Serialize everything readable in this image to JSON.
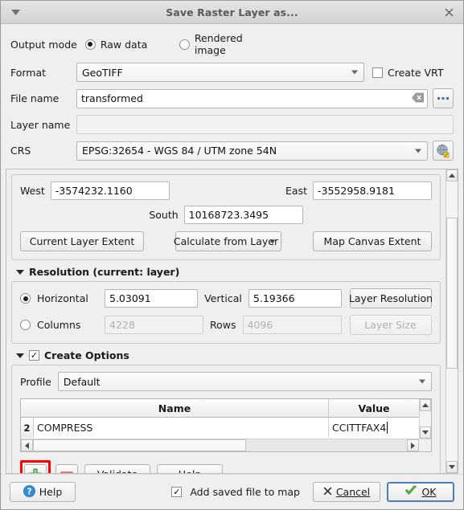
{
  "window": {
    "title": "Save Raster Layer as...",
    "menu_icon": "chevron-down-icon",
    "close_icon": "close-icon"
  },
  "output_mode": {
    "label": "Output mode",
    "options": [
      {
        "label": "Raw data",
        "selected": true
      },
      {
        "label": "Rendered image",
        "selected": false
      }
    ]
  },
  "format": {
    "label": "Format",
    "value": "GeoTIFF",
    "create_vrt": {
      "label": "Create VRT",
      "checked": false
    }
  },
  "file_name": {
    "label": "File name",
    "value": "transformed",
    "placeholder": "",
    "clear_icon": "clear-icon",
    "browse_label": "..."
  },
  "layer_name": {
    "label": "Layer name",
    "value": "",
    "placeholder": ""
  },
  "crs": {
    "label": "CRS",
    "value": "EPSG:32654 - WGS 84 / UTM zone 54N",
    "select_icon": "crs-globe-icon"
  },
  "extent": {
    "west": {
      "label": "West",
      "value": "-3574232.1160"
    },
    "east": {
      "label": "East",
      "value": "-3552958.9181"
    },
    "south": {
      "label": "South",
      "value": "10168723.3495"
    },
    "buttons": [
      "Current Layer Extent",
      "Calculate from Layer",
      "Map Canvas Extent"
    ],
    "calculate_has_dropdown": true
  },
  "resolution": {
    "section_title": "Resolution (current: layer)",
    "horizontal": {
      "label": "Horizontal",
      "value": "5.03091",
      "selected": true
    },
    "vertical": {
      "label": "Vertical",
      "value": "5.19366"
    },
    "layer_resolution_label": "Layer Resolution",
    "columns": {
      "label": "Columns",
      "value": "4228",
      "selected": false,
      "disabled": true
    },
    "rows": {
      "label": "Rows",
      "value": "4096",
      "disabled": true
    },
    "layer_size_label": "Layer Size",
    "layer_size_disabled": true
  },
  "create_options": {
    "section_title": "Create Options",
    "checked": true,
    "profile": {
      "label": "Profile",
      "value": "Default"
    },
    "table": {
      "columns": [
        "Name",
        "Value"
      ],
      "rows": [
        {
          "index": "2",
          "name": "COMPRESS",
          "value": "CCITTFAX4",
          "editing": true
        }
      ]
    },
    "buttons": {
      "add_icon": "add-plus-icon",
      "remove_icon": "remove-minus-icon",
      "validate_label": "Validate",
      "help_label": "Help"
    }
  },
  "footer": {
    "help_label": "Help",
    "help_icon": "help-question-icon",
    "add_saved_file": {
      "label": "Add saved file to map",
      "checked": true
    },
    "cancel_label": "Cancel",
    "cancel_icon": "cross-icon",
    "ok_label": "OK",
    "ok_icon": "check-icon"
  },
  "colors": {
    "highlight": "#ff0000",
    "accent": "#4a80b8",
    "ok_check": "#4caf2a",
    "add_green": "#2f8b2f",
    "remove_red": "#d03030",
    "help_blue": "#2f8fd8"
  }
}
